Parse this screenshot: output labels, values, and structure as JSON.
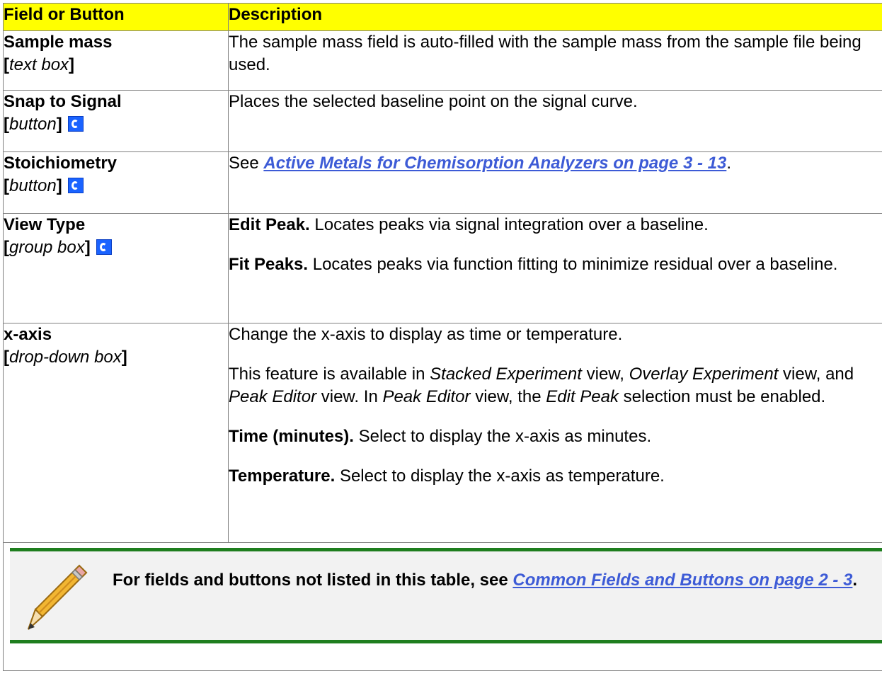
{
  "header": {
    "col1": "Field or Button",
    "col2": "Description"
  },
  "rows": [
    {
      "name": "Sample mass",
      "type_open": "[",
      "type": "text box",
      "type_close": "]",
      "has_icon": false,
      "desc": "The sample mass field is auto-filled with the sample mass from the sample file being used."
    },
    {
      "name": "Snap to Signal",
      "type_open": "[",
      "type": "button",
      "type_close": "]",
      "has_icon": true,
      "desc": "Places the selected baseline point on the signal curve."
    },
    {
      "name": "Stoichiometry",
      "type_open": "[",
      "type": "button",
      "type_close": "]",
      "has_icon": true,
      "desc_prefix": "See ",
      "desc_link": "Active Metals for Chemisorption Analyzers on page 3 - 13",
      "desc_suffix": "."
    },
    {
      "name": "View Type",
      "type_open": "[",
      "type": "group box",
      "type_close": "]",
      "has_icon": true,
      "p1_bold": "Edit Peak.",
      "p1": " Locates peaks via signal integration over a baseline.",
      "p2_bold": "Fit Peaks.",
      "p2": " Locates peaks via function fitting to minimize residual over a baseline."
    },
    {
      "name": "x-axis",
      "type_open": "[",
      "type": "drop-down box",
      "type_close": "]",
      "has_icon": false,
      "p1": "Change the x-axis to display as time or temperature.",
      "p2_a": "This feature is available in ",
      "p2_i1": "Stacked Experiment",
      "p2_b": " view, ",
      "p2_i2": "Overlay Experiment",
      "p2_c": " view, and ",
      "p2_i3": "Peak Editor",
      "p2_d": " view. In ",
      "p2_i4": "Peak Editor",
      "p2_e": " view, the ",
      "p2_i5": "Edit Peak",
      "p2_f": " selection must be enabled.",
      "p3_bold": "Time (minutes).",
      "p3": " Select to display the x-axis as minutes.",
      "p4_bold": "Temperature.",
      "p4": " Select to display the x-axis as temperature."
    }
  ],
  "note": {
    "text": "For fields and buttons not listed in this table, see ",
    "link": "Common Fields and Buttons on page 2 - 3",
    "suffix": "."
  },
  "colors": {
    "header_bg": "#ffff00",
    "icon_blue": "#1a63ff",
    "note_rule": "#1e7e1e",
    "link": "#3d5bd6"
  },
  "icons": {
    "row_button_icon": "c-icon",
    "note_icon": "pencil-icon"
  }
}
